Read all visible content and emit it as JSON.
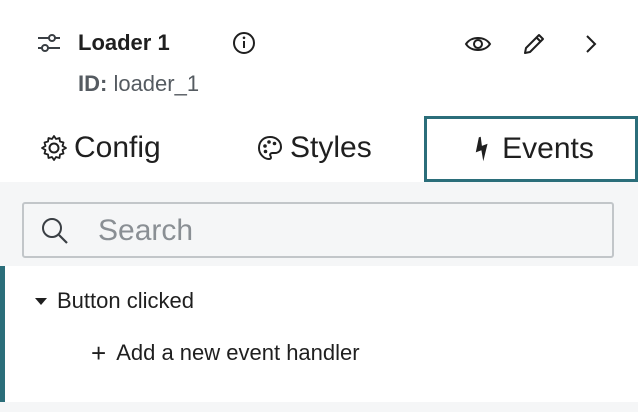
{
  "component": {
    "title": "Loader 1",
    "id_label": "ID:",
    "id_value": "loader_1",
    "icons": [
      "sliders-icon",
      "info-icon",
      "eye-icon",
      "pencil-icon",
      "chevron-right-icon"
    ]
  },
  "tabs": [
    {
      "label": "Config",
      "icon": "gear-icon"
    },
    {
      "label": "Styles",
      "icon": "palette-icon"
    },
    {
      "label": "Events",
      "icon": "lightning-icon",
      "active": true
    }
  ],
  "search": {
    "placeholder": "Search",
    "value": ""
  },
  "events": {
    "group_label": "Button clicked",
    "add_handler_label": "Add a new event handler"
  },
  "colors": {
    "accent": "#2b6e7a",
    "panel_bg": "#f5f6f7",
    "border": "#c2c6c9"
  }
}
